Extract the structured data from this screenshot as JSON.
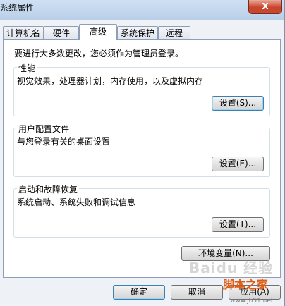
{
  "window": {
    "title": "系统属性",
    "close_glyph": "X"
  },
  "tabs": [
    {
      "label": "计算机名",
      "active": false
    },
    {
      "label": "硬件",
      "active": false
    },
    {
      "label": "高级",
      "active": true
    },
    {
      "label": "系统保护",
      "active": false
    },
    {
      "label": "远程",
      "active": false
    }
  ],
  "panel": {
    "note": "要进行大多数更改，您必须作为管理员登录。",
    "performance": {
      "legend": "性能",
      "desc": "视觉效果，处理器计划，内存使用，以及虚拟内存",
      "button": "设置(S)..."
    },
    "profiles": {
      "legend": "用户配置文件",
      "desc": "与您登录有关的桌面设置",
      "button": "设置(E)..."
    },
    "startup": {
      "legend": "启动和故障恢复",
      "desc": "系统启动、系统失败和调试信息",
      "button": "设置(T)..."
    },
    "env_button": "环境变量(N)..."
  },
  "footer": {
    "ok": "确定",
    "cancel": "取消",
    "apply": "应用(A)"
  },
  "watermark": {
    "text": "Baidu 经验",
    "site": "脚本之家",
    "url": "www.jb51.net"
  },
  "colors": {
    "close_red": "#c8442a",
    "accent": "#3c7fb1",
    "watermark_orange": "#e05a10"
  }
}
